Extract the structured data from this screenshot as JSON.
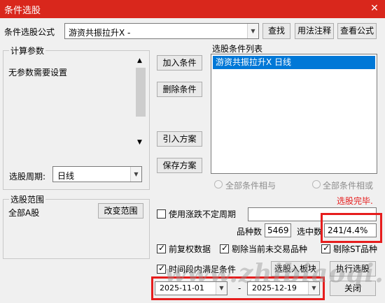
{
  "window": {
    "title": "条件选股",
    "close_glyph": "✕"
  },
  "formula": {
    "label": "条件选股公式",
    "value": "游资共振拉升X  -"
  },
  "buttons": {
    "find": "查找",
    "usage": "用法注释",
    "view_formula": "查看公式",
    "add_condition": "加入条件",
    "delete_condition": "删除条件",
    "import_plan": "引入方案",
    "save_plan": "保存方案",
    "change_range": "改变范围",
    "select_to_board": "选股入板块",
    "execute": "执行选股",
    "close": "关闭"
  },
  "params": {
    "legend": "计算参数",
    "text": "无参数需要设置",
    "period_label": "选股周期:",
    "period_value": "日线"
  },
  "conditions": {
    "legend": "选股条件列表",
    "items": [
      "游资共振拉升X  日线"
    ]
  },
  "logic": {
    "all_and": "全部条件相与",
    "all_or": "全部条件相或"
  },
  "status": {
    "text": "选股完毕.",
    "color": "#e61d1d"
  },
  "range": {
    "legend": "选股范围",
    "value": "全部A股"
  },
  "options": {
    "use_irregular_period": "使用涨跌不定周期",
    "adjusted_data": "前复权数据",
    "exclude_untraded": "剔除当前未交易品种",
    "exclude_st": "剔除ST品种",
    "time_range": "时间段内满足条件"
  },
  "stats": {
    "count_label": "品种数",
    "count_value": "5469",
    "selected_label": "选中数",
    "selected_value": "241/4.4%"
  },
  "dates": {
    "start": "2025-11-01",
    "separator": "-",
    "end": "2025-12-19"
  },
  "watermark": "www.zhibiaoqi.com",
  "colors": {
    "titlebar": "#d9271c",
    "selection": "#0078d7",
    "highlight_box": "#e61d1d"
  }
}
